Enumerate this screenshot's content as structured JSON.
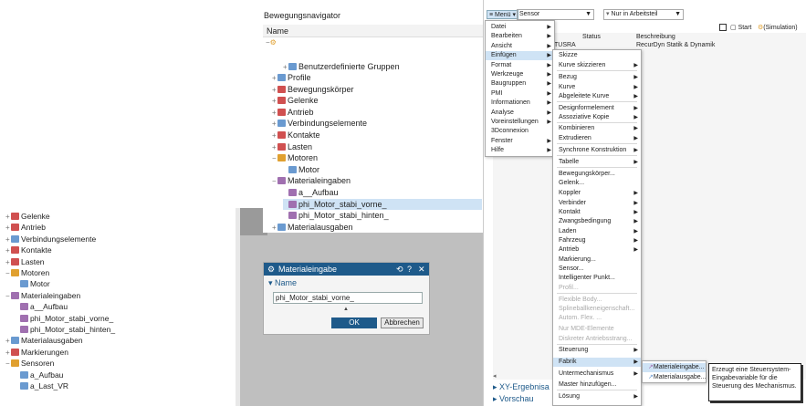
{
  "left_tree": {
    "items": [
      {
        "exp": "+",
        "label": "Gelenke",
        "color": "#d05050"
      },
      {
        "exp": "+",
        "label": "Antrieb",
        "color": "#d05050"
      },
      {
        "exp": "+",
        "label": "Verbindungselemente",
        "color": "#6a9ad0"
      },
      {
        "exp": "+",
        "label": "Kontakte",
        "color": "#d05050"
      },
      {
        "exp": "+",
        "label": "Lasten",
        "color": "#d05050"
      },
      {
        "exp": "−",
        "label": "Motoren",
        "color": "#e0a030"
      },
      {
        "exp": "",
        "label": "Motor",
        "color": "#6a9ad0"
      },
      {
        "exp": "−",
        "label": "Materialeingaben",
        "color": "#a070b0"
      },
      {
        "exp": "",
        "label": "a__Aufbau",
        "color": "#a070b0"
      },
      {
        "exp": "",
        "label": "phi_Motor_stabi_vorne_",
        "color": "#a070b0"
      },
      {
        "exp": "",
        "label": "phi_Motor_stabi_hinten_",
        "color": "#a070b0"
      },
      {
        "exp": "+",
        "label": "Materialausgaben",
        "color": "#6a9ad0"
      },
      {
        "exp": "+",
        "label": "Markierungen",
        "color": "#d05050"
      },
      {
        "exp": "−",
        "label": "Sensoren",
        "color": "#e0a030"
      },
      {
        "exp": "",
        "label": "a_Aufbau",
        "color": "#6a9ad0"
      },
      {
        "exp": "",
        "label": "a_Last_VR",
        "color": "#6a9ad0"
      }
    ]
  },
  "navigator": {
    "title": "Bewegungsnavigator",
    "column": "Name",
    "items": [
      {
        "exp": "+",
        "label": "Benutzerdefinierte Gruppen",
        "color": "#6a9ad0"
      },
      {
        "exp": "+",
        "label": "Profile",
        "color": "#6a9ad0"
      },
      {
        "exp": "+",
        "label": "Bewegungskörper",
        "color": "#d05050"
      },
      {
        "exp": "+",
        "label": "Gelenke",
        "color": "#d05050"
      },
      {
        "exp": "+",
        "label": "Antrieb",
        "color": "#d05050"
      },
      {
        "exp": "+",
        "label": "Verbindungselemente",
        "color": "#6a9ad0"
      },
      {
        "exp": "+",
        "label": "Kontakte",
        "color": "#d05050"
      },
      {
        "exp": "+",
        "label": "Lasten",
        "color": "#d05050"
      },
      {
        "exp": "−",
        "label": "Motoren",
        "color": "#e0a030"
      },
      {
        "exp": "",
        "label": "Motor",
        "color": "#6a9ad0"
      },
      {
        "exp": "−",
        "label": "Materialeingaben",
        "color": "#a070b0"
      },
      {
        "exp": "",
        "label": "a__Aufbau",
        "color": "#a070b0"
      },
      {
        "exp": "",
        "label": "phi_Motor_stabi_vorne_",
        "color": "#a070b0"
      },
      {
        "exp": "",
        "label": "phi_Motor_stabi_hinten_",
        "color": "#a070b0"
      },
      {
        "exp": "+",
        "label": "Materialausgaben",
        "color": "#6a9ad0"
      }
    ]
  },
  "dialog": {
    "title": "Materialeingabe",
    "title_icons": [
      "⟲",
      "?",
      "✕"
    ],
    "section": "Name",
    "name_value": "phi_Motor_stabi_vorne_",
    "ok": "OK",
    "cancel": "Abbrechen"
  },
  "toolbar": {
    "menu": "Menü",
    "type_select": "Sensor",
    "scope_select": "Nur in Arbeitsteil",
    "start": "Start",
    "simulation": "(Simulation)"
  },
  "table": {
    "col_status": "Status",
    "col_desc": "Beschreibung",
    "row_name_fragment": "TUSRA",
    "row_desc": "RecurDyn Statik & Dynamik"
  },
  "main_menu": [
    "Datei",
    "Bearbeiten",
    "Ansicht",
    "Einfügen",
    "Format",
    "Werkzeuge",
    "Baugruppen",
    "PMI",
    "Informationen",
    "Analyse",
    "Voreinstellungen",
    "3Dconnexion",
    "Fenster",
    "Hilfe"
  ],
  "insert_menu": [
    {
      "label": "Skizze",
      "sub": false,
      "dis": false
    },
    {
      "label": "Kurve skizzieren",
      "sub": true,
      "dis": false
    },
    {
      "label": "Bezug",
      "sub": true,
      "dis": false
    },
    {
      "label": "Kurve",
      "sub": true,
      "dis": false
    },
    {
      "label": "Abgeleitete Kurve",
      "sub": true,
      "dis": false
    },
    {
      "label": "Designformelement",
      "sub": true,
      "dis": false
    },
    {
      "label": "Assoziative Kopie",
      "sub": true,
      "dis": false
    },
    {
      "label": "Kombinieren",
      "sub": true,
      "dis": false
    },
    {
      "label": "Extrudieren",
      "sub": true,
      "dis": false
    },
    {
      "label": "Synchrone Konstruktion",
      "sub": true,
      "dis": false
    },
    {
      "label": "Tabelle",
      "sub": true,
      "dis": false
    },
    {
      "label": "Bewegungskörper...",
      "sub": false,
      "dis": false
    },
    {
      "label": "Gelenk...",
      "sub": false,
      "dis": false
    },
    {
      "label": "Koppler",
      "sub": true,
      "dis": false
    },
    {
      "label": "Verbinder",
      "sub": true,
      "dis": false
    },
    {
      "label": "Kontakt",
      "sub": true,
      "dis": false
    },
    {
      "label": "Zwangsbedingung",
      "sub": true,
      "dis": false
    },
    {
      "label": "Laden",
      "sub": true,
      "dis": false
    },
    {
      "label": "Fahrzeug",
      "sub": true,
      "dis": false
    },
    {
      "label": "Antrieb",
      "sub": true,
      "dis": false
    },
    {
      "label": "Markierung...",
      "sub": false,
      "dis": false
    },
    {
      "label": "Sensor...",
      "sub": false,
      "dis": false
    },
    {
      "label": "Intelligenter Punkt...",
      "sub": false,
      "dis": false
    },
    {
      "label": "Profil...",
      "sub": false,
      "dis": true
    },
    {
      "label": "Flexible Body...",
      "sub": false,
      "dis": true
    },
    {
      "label": "Splineballkeneigenschaft...",
      "sub": false,
      "dis": true
    },
    {
      "label": "Autom. Flex. ...",
      "sub": false,
      "dis": true
    },
    {
      "label": "Nur MDE-Elemente",
      "sub": false,
      "dis": true
    },
    {
      "label": "Diskreter Antriebsstrang...",
      "sub": false,
      "dis": true
    },
    {
      "label": "Steuerung",
      "sub": true,
      "dis": false
    },
    {
      "label": "Fabrik",
      "sub": true,
      "dis": false
    },
    {
      "label": "Untermechanismus",
      "sub": true,
      "dis": false
    },
    {
      "label": "Master hinzufügen...",
      "sub": false,
      "dis": false
    },
    {
      "label": "Lösung",
      "sub": true,
      "dis": false
    }
  ],
  "fabrik_menu": [
    "Materialeingabe...",
    "Materialausgabe..."
  ],
  "tooltip": "Erzeugt eine Steuersystem-Eingabevariable für die Steuerung des Mechanismus.",
  "bottom_panels": [
    "XY-Ergebnisa",
    "Vorschau"
  ]
}
